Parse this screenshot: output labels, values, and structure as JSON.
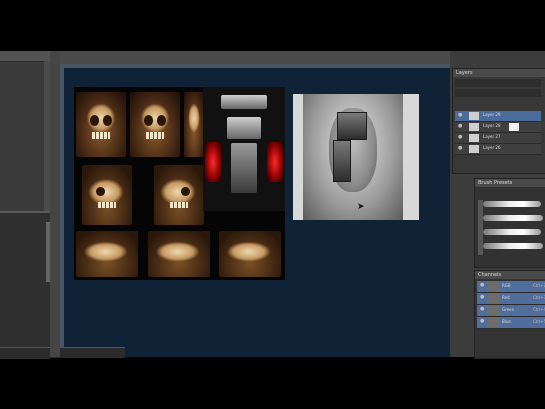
{
  "app": "Photoshop",
  "layers_panel": {
    "tab": "Layers",
    "layers": [
      {
        "name": "Layer 29"
      },
      {
        "name": "Layer 28"
      },
      {
        "name": "Layer 27"
      },
      {
        "name": "Layer 26"
      }
    ]
  },
  "brush_presets_panel": {
    "tab": "Brush Presets"
  },
  "channels_panel": {
    "tab": "Channels",
    "channels": [
      {
        "name": "RGB",
        "key": "Ctrl+2"
      },
      {
        "name": "Red",
        "key": "Ctrl+3"
      },
      {
        "name": "Green",
        "key": "Ctrl+4"
      },
      {
        "name": "Blue",
        "key": "Ctrl+5"
      }
    ]
  },
  "colors": {
    "document_bg": "#0f2236",
    "ui_dark": "#3a3a3a",
    "selection": "#4b6c9a"
  },
  "icons": [
    "eye-icon",
    "cursor-icon"
  ]
}
